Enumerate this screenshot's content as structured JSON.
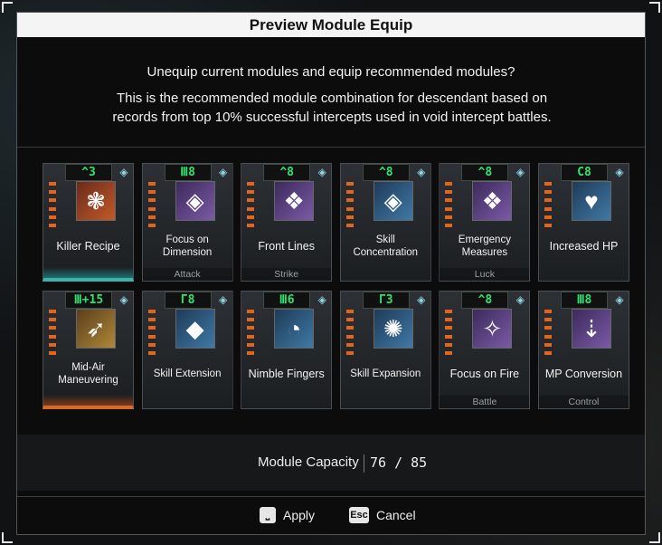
{
  "dialog": {
    "title": "Preview Module Equip",
    "message_main": "Unequip current modules and equip recommended modules?",
    "message_detail": "This is the recommended module combination for descendant based on records from top 10% successful intercepts used in void intercept battles."
  },
  "modules": [
    {
      "name": "Killer Recipe",
      "capacity": "^3",
      "category": "",
      "color": "red",
      "glyph": "❃",
      "frame": "teal"
    },
    {
      "name": "Focus on Dimension",
      "capacity": "Ⅲ8",
      "category": "Attack",
      "color": "purple",
      "glyph": "◈",
      "frame": ""
    },
    {
      "name": "Front Lines",
      "capacity": "^8",
      "category": "Strike",
      "color": "purple",
      "glyph": "❖",
      "frame": ""
    },
    {
      "name": "Skill Concentration",
      "capacity": "^8",
      "category": "",
      "color": "blue",
      "glyph": "◈",
      "frame": ""
    },
    {
      "name": "Emergency Measures",
      "capacity": "^8",
      "category": "Luck",
      "color": "purple",
      "glyph": "❖",
      "frame": ""
    },
    {
      "name": "Increased HP",
      "capacity": "C8",
      "category": "",
      "color": "blue",
      "glyph": "♥",
      "frame": ""
    },
    {
      "name": "Mid-Air Maneuvering",
      "capacity": "Ⅲ+15",
      "category": "",
      "color": "gold",
      "glyph": "➶",
      "frame": "orange"
    },
    {
      "name": "Skill Extension",
      "capacity": "Γ8",
      "category": "",
      "color": "blue",
      "glyph": "◆",
      "frame": ""
    },
    {
      "name": "Nimble Fingers",
      "capacity": "Ⅲ6",
      "category": "",
      "color": "blue",
      "glyph": "◔",
      "frame": ""
    },
    {
      "name": "Skill Expansion",
      "capacity": "Γ3",
      "category": "",
      "color": "blue",
      "glyph": "✺",
      "frame": ""
    },
    {
      "name": "Focus on Fire",
      "capacity": "^8",
      "category": "Battle",
      "color": "purple",
      "glyph": "✧",
      "frame": ""
    },
    {
      "name": "MP Conversion",
      "capacity": "Ⅲ8",
      "category": "Control",
      "color": "purple",
      "glyph": "⇣",
      "frame": ""
    }
  ],
  "capacity": {
    "label": "Module Capacity",
    "value": "76 / 85"
  },
  "footer": {
    "apply_key": "⎵",
    "apply_label": "Apply",
    "cancel_key": "Esc",
    "cancel_label": "Cancel"
  },
  "colors": {
    "capacity_text": "#2fe36f",
    "bar_orange": "#e2651e",
    "teal_frame": "#38b3b0",
    "orange_frame": "#d76a2a"
  }
}
